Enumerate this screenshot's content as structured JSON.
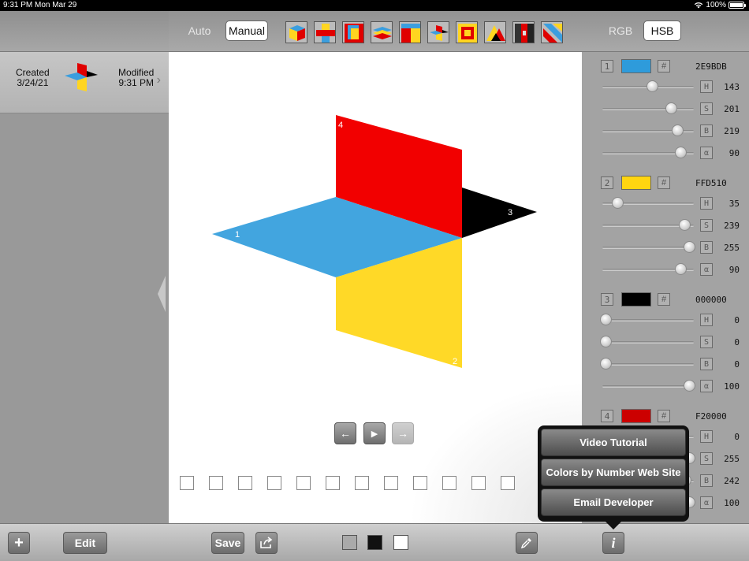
{
  "status_bar": {
    "time": "9:31 PM",
    "date": "Mon Mar 29",
    "battery": "100%"
  },
  "document": {
    "created_label": "Created",
    "created_date": "3/24/21",
    "modified_label": "Modified",
    "modified_time": "9:31 PM"
  },
  "mode_tabs": {
    "auto": "Auto",
    "manual": "Manual",
    "selected": "Manual"
  },
  "color_model_tabs": {
    "rgb": "RGB",
    "hsb": "HSB",
    "selected": "HSB"
  },
  "left_toolbar": {
    "add": "+",
    "edit": "Edit"
  },
  "center_toolbar": {
    "save": "Save",
    "swatches": [
      "#aaaaaa",
      "#111111",
      "#ffffff"
    ]
  },
  "canvas": {
    "labels": [
      "1",
      "2",
      "3",
      "4"
    ],
    "frames_count_note": "",
    "nav": {
      "prev": "←",
      "play": "▶",
      "next": "→"
    }
  },
  "colors": [
    {
      "index": "1",
      "hex": "2E9BDB",
      "swatch": "#2E9BDB",
      "channels": [
        {
          "label": "H",
          "value": "143",
          "level": 0.56
        },
        {
          "label": "S",
          "value": "201",
          "level": 0.78
        },
        {
          "label": "B",
          "value": "219",
          "level": 0.86
        },
        {
          "label": "α",
          "value": "90",
          "level": 0.9
        }
      ]
    },
    {
      "index": "2",
      "hex": "FFD510",
      "swatch": "#FFD510",
      "channels": [
        {
          "label": "H",
          "value": "35",
          "level": 0.14
        },
        {
          "label": "S",
          "value": "239",
          "level": 0.94
        },
        {
          "label": "B",
          "value": "255",
          "level": 1.0
        },
        {
          "label": "α",
          "value": "90",
          "level": 0.9
        }
      ]
    },
    {
      "index": "3",
      "hex": "000000",
      "swatch": "#000000",
      "channels": [
        {
          "label": "H",
          "value": "0",
          "level": 0.0
        },
        {
          "label": "S",
          "value": "0",
          "level": 0.0
        },
        {
          "label": "B",
          "value": "0",
          "level": 0.0
        },
        {
          "label": "α",
          "value": "100",
          "level": 1.0
        }
      ]
    },
    {
      "index": "4",
      "hex": "F20000",
      "swatch": "#CC0000",
      "channels": [
        {
          "label": "H",
          "value": "0",
          "level": 0.0
        },
        {
          "label": "S",
          "value": "255",
          "level": 1.0
        },
        {
          "label": "B",
          "value": "242",
          "level": 0.95
        },
        {
          "label": "α",
          "value": "100",
          "level": 1.0
        }
      ]
    }
  ],
  "info_menu": {
    "items": [
      "Video Tutorial",
      "Colors by Number Web Site",
      "Email Developer"
    ],
    "info_button": "i"
  }
}
